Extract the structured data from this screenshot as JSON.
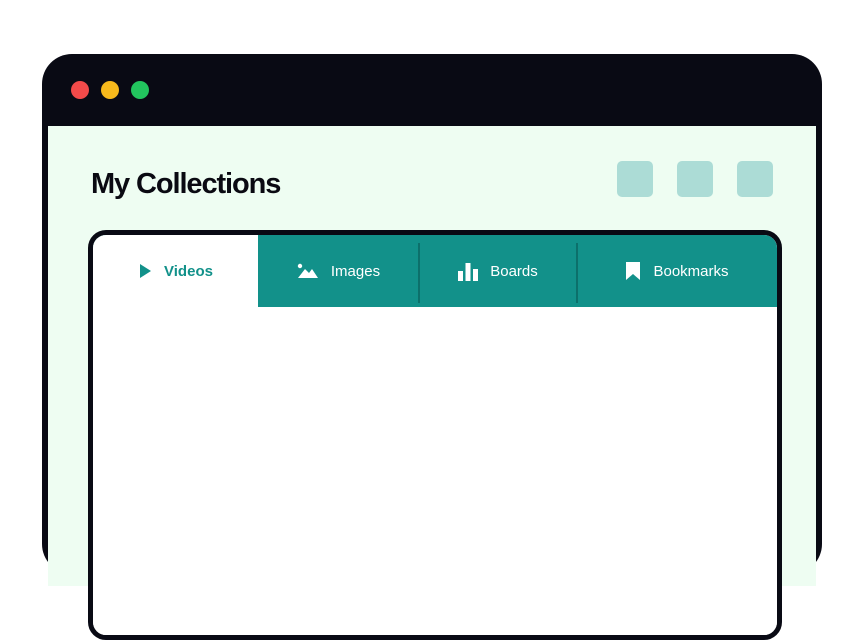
{
  "window": {
    "controls": [
      "close",
      "minimize",
      "maximize"
    ],
    "colors": {
      "close": "#f24a4a",
      "minimize": "#f7b91c",
      "maximize": "#22c55e",
      "frame": "#090a14"
    }
  },
  "header": {
    "title": "My Collections",
    "action_buttons": [
      "action-button-1",
      "action-button-2",
      "action-button-3"
    ]
  },
  "tabs": {
    "active_index": 0,
    "items": [
      {
        "label": "Videos",
        "icon": "play-icon"
      },
      {
        "label": "Images",
        "icon": "image-icon"
      },
      {
        "label": "Boards",
        "icon": "bar-chart-icon"
      },
      {
        "label": "Bookmarks",
        "icon": "bookmark-icon"
      }
    ]
  },
  "colors": {
    "accent": "#12918a",
    "page_background": "#eefdf2",
    "header_button": "#acdcd6"
  }
}
